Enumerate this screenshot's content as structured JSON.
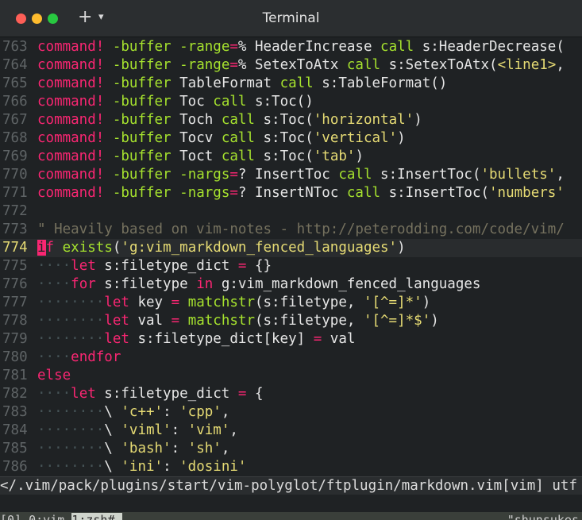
{
  "window": {
    "title": "Terminal",
    "new_tab_icon": "+",
    "tab_menu_icon": "▾"
  },
  "lines": [
    {
      "n": "763",
      "segs": [
        [
          "kw",
          "command!"
        ],
        [
          "t",
          " "
        ],
        [
          "fn",
          "-buffer"
        ],
        [
          "t",
          " "
        ],
        [
          "fn",
          "-range"
        ],
        [
          "kw",
          "="
        ],
        [
          "t",
          "% HeaderIncrease "
        ],
        [
          "fn",
          "call"
        ],
        [
          "t",
          " s:HeaderDecrease("
        ]
      ]
    },
    {
      "n": "764",
      "segs": [
        [
          "kw",
          "command!"
        ],
        [
          "t",
          " "
        ],
        [
          "fn",
          "-buffer"
        ],
        [
          "t",
          " "
        ],
        [
          "fn",
          "-range"
        ],
        [
          "kw",
          "="
        ],
        [
          "t",
          "% SetexToAtx "
        ],
        [
          "fn",
          "call"
        ],
        [
          "t",
          " s:SetexToAtx("
        ],
        [
          "str",
          "<line1>"
        ],
        [
          "t",
          ","
        ]
      ]
    },
    {
      "n": "765",
      "segs": [
        [
          "kw",
          "command!"
        ],
        [
          "t",
          " "
        ],
        [
          "fn",
          "-buffer"
        ],
        [
          "t",
          " TableFormat "
        ],
        [
          "fn",
          "call"
        ],
        [
          "t",
          " s:TableFormat()"
        ]
      ]
    },
    {
      "n": "766",
      "segs": [
        [
          "kw",
          "command!"
        ],
        [
          "t",
          " "
        ],
        [
          "fn",
          "-buffer"
        ],
        [
          "t",
          " Toc "
        ],
        [
          "fn",
          "call"
        ],
        [
          "t",
          " s:Toc()"
        ]
      ]
    },
    {
      "n": "767",
      "segs": [
        [
          "kw",
          "command!"
        ],
        [
          "t",
          " "
        ],
        [
          "fn",
          "-buffer"
        ],
        [
          "t",
          " Toch "
        ],
        [
          "fn",
          "call"
        ],
        [
          "t",
          " s:Toc("
        ],
        [
          "str",
          "'horizontal'"
        ],
        [
          "t",
          ")"
        ]
      ]
    },
    {
      "n": "768",
      "segs": [
        [
          "kw",
          "command!"
        ],
        [
          "t",
          " "
        ],
        [
          "fn",
          "-buffer"
        ],
        [
          "t",
          " Tocv "
        ],
        [
          "fn",
          "call"
        ],
        [
          "t",
          " s:Toc("
        ],
        [
          "str",
          "'vertical'"
        ],
        [
          "t",
          ")"
        ]
      ]
    },
    {
      "n": "769",
      "segs": [
        [
          "kw",
          "command!"
        ],
        [
          "t",
          " "
        ],
        [
          "fn",
          "-buffer"
        ],
        [
          "t",
          " Toct "
        ],
        [
          "fn",
          "call"
        ],
        [
          "t",
          " s:Toc("
        ],
        [
          "str",
          "'tab'"
        ],
        [
          "t",
          ")"
        ]
      ]
    },
    {
      "n": "770",
      "segs": [
        [
          "kw",
          "command!"
        ],
        [
          "t",
          " "
        ],
        [
          "fn",
          "-buffer"
        ],
        [
          "t",
          " "
        ],
        [
          "fn",
          "-nargs"
        ],
        [
          "kw",
          "="
        ],
        [
          "t",
          "? InsertToc "
        ],
        [
          "fn",
          "call"
        ],
        [
          "t",
          " s:InsertToc("
        ],
        [
          "str",
          "'bullets'"
        ],
        [
          "t",
          ","
        ]
      ]
    },
    {
      "n": "771",
      "segs": [
        [
          "kw",
          "command!"
        ],
        [
          "t",
          " "
        ],
        [
          "fn",
          "-buffer"
        ],
        [
          "t",
          " "
        ],
        [
          "fn",
          "-nargs"
        ],
        [
          "kw",
          "="
        ],
        [
          "t",
          "? InsertNToc "
        ],
        [
          "fn",
          "call"
        ],
        [
          "t",
          " s:InsertToc("
        ],
        [
          "str",
          "'numbers'"
        ]
      ]
    },
    {
      "n": "772",
      "segs": []
    },
    {
      "n": "773",
      "segs": [
        [
          "cmt",
          "\" Heavily based on vim-notes - http://peterodding.com/code/vim/"
        ]
      ]
    },
    {
      "n": "774",
      "cur": true,
      "segs": [
        [
          "cursor",
          "i"
        ],
        [
          "kw",
          "f"
        ],
        [
          "t",
          " "
        ],
        [
          "fn",
          "exists"
        ],
        [
          "t",
          "("
        ],
        [
          "str",
          "'g:vim_markdown_fenced_languages'"
        ],
        [
          "t",
          ")"
        ]
      ]
    },
    {
      "n": "775",
      "segs": [
        [
          "lead",
          "····"
        ],
        [
          "kw",
          "let"
        ],
        [
          "t",
          " s:filetype_dict "
        ],
        [
          "kw",
          "="
        ],
        [
          "t",
          " {}"
        ]
      ]
    },
    {
      "n": "776",
      "segs": [
        [
          "lead",
          "····"
        ],
        [
          "kw",
          "for"
        ],
        [
          "t",
          " s:filetype "
        ],
        [
          "kw",
          "in"
        ],
        [
          "t",
          " g:vim_markdown_fenced_languages"
        ]
      ]
    },
    {
      "n": "777",
      "segs": [
        [
          "lead",
          "········"
        ],
        [
          "kw",
          "let"
        ],
        [
          "t",
          " key "
        ],
        [
          "kw",
          "="
        ],
        [
          "t",
          " "
        ],
        [
          "fn",
          "matchstr"
        ],
        [
          "t",
          "(s:filetype, "
        ],
        [
          "str",
          "'[^=]*'"
        ],
        [
          "t",
          ")"
        ]
      ]
    },
    {
      "n": "778",
      "segs": [
        [
          "lead",
          "········"
        ],
        [
          "kw",
          "let"
        ],
        [
          "t",
          " val "
        ],
        [
          "kw",
          "="
        ],
        [
          "t",
          " "
        ],
        [
          "fn",
          "matchstr"
        ],
        [
          "t",
          "(s:filetype, "
        ],
        [
          "str",
          "'[^=]*$'"
        ],
        [
          "t",
          ")"
        ]
      ]
    },
    {
      "n": "779",
      "segs": [
        [
          "lead",
          "········"
        ],
        [
          "kw",
          "let"
        ],
        [
          "t",
          " s:filetype_dict[key] "
        ],
        [
          "kw",
          "="
        ],
        [
          "t",
          " val"
        ]
      ]
    },
    {
      "n": "780",
      "segs": [
        [
          "lead",
          "····"
        ],
        [
          "kw",
          "endfor"
        ]
      ]
    },
    {
      "n": "781",
      "segs": [
        [
          "kw",
          "else"
        ]
      ]
    },
    {
      "n": "782",
      "segs": [
        [
          "lead",
          "····"
        ],
        [
          "kw",
          "let"
        ],
        [
          "t",
          " s:filetype_dict "
        ],
        [
          "kw",
          "="
        ],
        [
          "t",
          " {"
        ]
      ]
    },
    {
      "n": "783",
      "segs": [
        [
          "lead",
          "········"
        ],
        [
          "t",
          "\\ "
        ],
        [
          "str",
          "'c++'"
        ],
        [
          "t",
          ": "
        ],
        [
          "str",
          "'cpp'"
        ],
        [
          "t",
          ","
        ]
      ]
    },
    {
      "n": "784",
      "segs": [
        [
          "lead",
          "········"
        ],
        [
          "t",
          "\\ "
        ],
        [
          "str",
          "'viml'"
        ],
        [
          "t",
          ": "
        ],
        [
          "str",
          "'vim'"
        ],
        [
          "t",
          ","
        ]
      ]
    },
    {
      "n": "785",
      "segs": [
        [
          "lead",
          "········"
        ],
        [
          "t",
          "\\ "
        ],
        [
          "str",
          "'bash'"
        ],
        [
          "t",
          ": "
        ],
        [
          "str",
          "'sh'"
        ],
        [
          "t",
          ","
        ]
      ]
    },
    {
      "n": "786",
      "segs": [
        [
          "lead",
          "········"
        ],
        [
          "t",
          "\\ "
        ],
        [
          "str",
          "'ini'"
        ],
        [
          "t",
          ": "
        ],
        [
          "str",
          "'dosini'"
        ]
      ]
    }
  ],
  "statusline": "</.vim/pack/plugins/start/vim-polyglot/ftplugin/markdown.vim[vim] utf",
  "tmux": {
    "left": "[0] 0:vim ",
    "active": "1:zsh#-",
    "right": "\"shunsukes"
  },
  "colors": {
    "keyword": "#f92672",
    "function": "#a6e22e",
    "string": "#e6db74",
    "comment": "#75715e",
    "background": "#1f2224"
  }
}
